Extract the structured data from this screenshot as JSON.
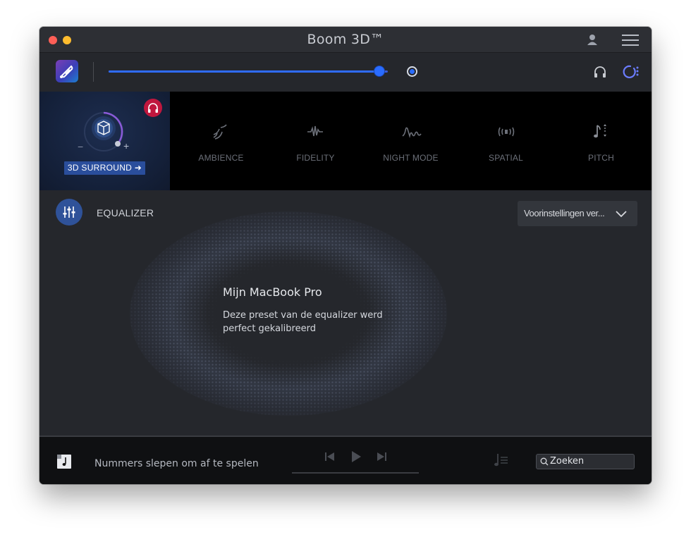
{
  "app": {
    "title": "Boom 3D™"
  },
  "volume": {
    "level": 0.97
  },
  "effects": {
    "surround": {
      "label": "3D SURROUND ➜"
    },
    "items": [
      {
        "label": "AMBIENCE",
        "icon": "ambience-icon"
      },
      {
        "label": "FIDELITY",
        "icon": "fidelity-icon"
      },
      {
        "label": "NIGHT MODE",
        "icon": "night-mode-icon"
      },
      {
        "label": "SPATIAL",
        "icon": "spatial-icon"
      },
      {
        "label": "PITCH",
        "icon": "pitch-icon"
      }
    ]
  },
  "equalizer": {
    "label": "EQUALIZER",
    "preset_selected": "Voorinstellingen ver...",
    "device_name": "Mijn MacBook Pro",
    "device_description": "Deze preset van de equalizer werd perfect gekalibreerd"
  },
  "player": {
    "drop_text": "Nummers slepen om af te spelen",
    "search_placeholder": "Zoeken"
  },
  "colors": {
    "accent": "#2f6bff",
    "headphone_badge": "#c0173e",
    "surround_button": "#2a4e9c"
  }
}
